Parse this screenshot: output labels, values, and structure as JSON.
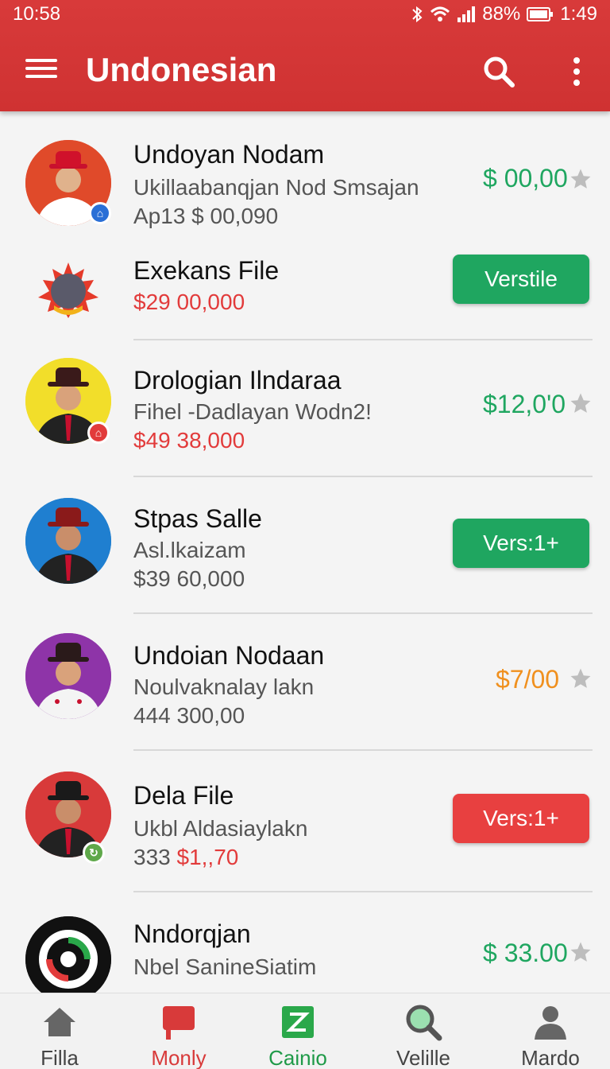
{
  "status": {
    "time": "10:58",
    "battery": "88%",
    "clock_right": "1:49"
  },
  "toolbar": {
    "title": "Undonesian"
  },
  "colors": {
    "accent": "#d83a3a",
    "green": "#1fa660",
    "orange": "#f0901e",
    "red": "#e23b3b"
  },
  "items": [
    {
      "name": "Undoyan Nodam",
      "sub1": "Ukillaabanqjan Nod Smsajan",
      "sub2": "Ap13 $ 00,090",
      "price": "$ 00,00",
      "starred": true,
      "avatar_color": "#e04a2a"
    },
    {
      "name": "Exekans File",
      "sub1": "$29 00,000",
      "button": "Verstile"
    },
    {
      "name": "Drologian Ilndaraa",
      "sub1": "Fihel -Dadlayan Wodn2!",
      "sub2": "$49 38,000",
      "price": "$12,0'0",
      "starred": true,
      "avatar_color": "#f2de2a"
    },
    {
      "name": "Stpas Salle",
      "sub1": "Asl.lkaizam",
      "sub2": "$39 60,000",
      "button": "Vers:1+"
    },
    {
      "name": "Undoian Nodaan",
      "sub1": "Noulvaknalay lakn",
      "sub2": "444 300,00",
      "price": "$7/00",
      "starred": true,
      "avatar_color": "#8e34a8"
    },
    {
      "name": "Dela File",
      "sub1": "Ukbl Aldasiaylakn",
      "sub2_a": "333",
      "sub2_b": "$1,,70",
      "button": "Vers:1+"
    },
    {
      "name": "Nndorqjan",
      "sub1": "Nbel SanineSiatim",
      "price": "$ 33.00",
      "starred": true
    }
  ],
  "nav": [
    {
      "label": "Filla",
      "icon": "home-icon"
    },
    {
      "label": "Monly",
      "icon": "flag-icon"
    },
    {
      "label": "Cainio",
      "icon": "zone-icon"
    },
    {
      "label": "Velille",
      "icon": "search-icon"
    },
    {
      "label": "Mardo",
      "icon": "person-icon"
    }
  ]
}
